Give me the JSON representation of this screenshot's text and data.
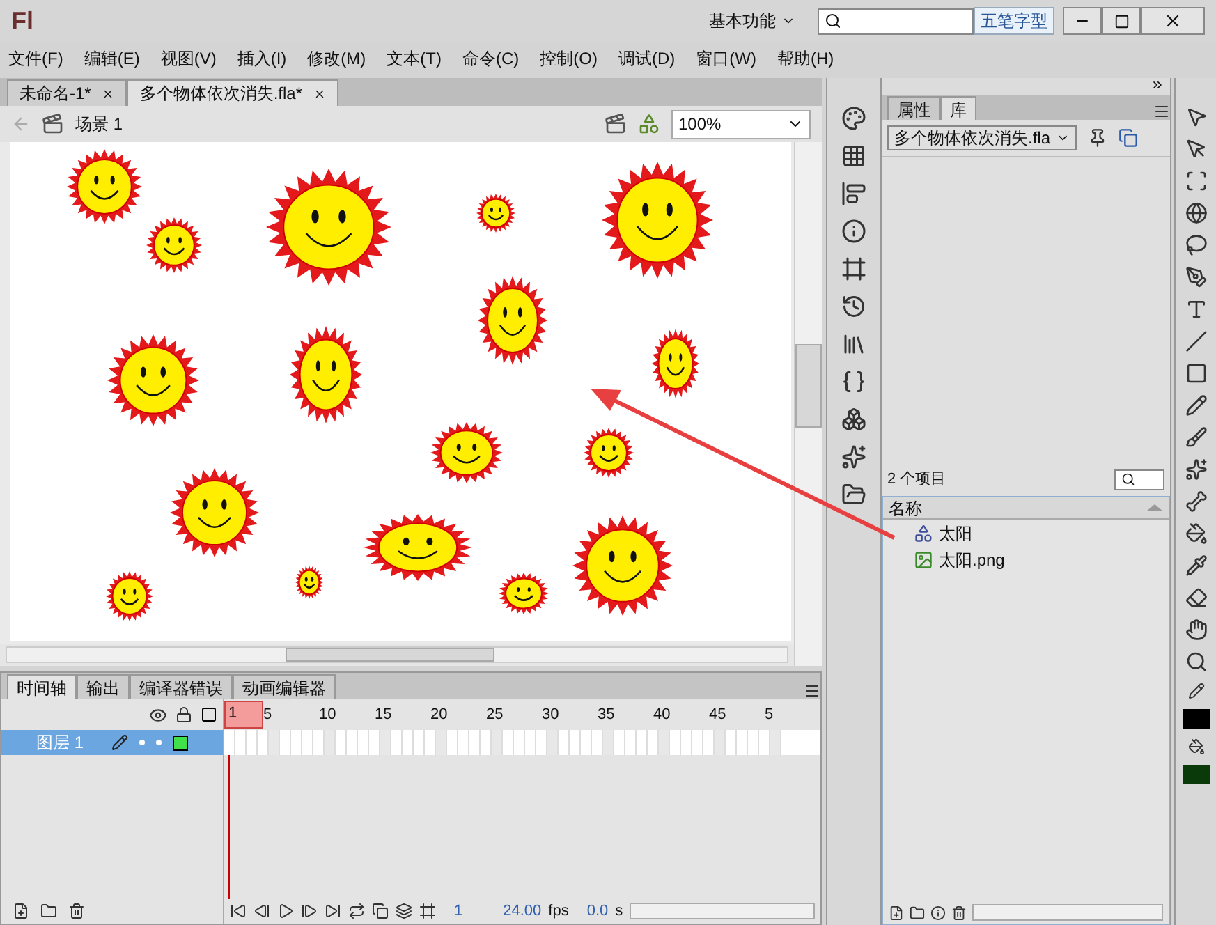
{
  "app": {
    "logo": "Fl",
    "workspace": "基本功能",
    "ime": "五笔字型"
  },
  "menu": [
    "文件(F)",
    "编辑(E)",
    "视图(V)",
    "插入(I)",
    "修改(M)",
    "文本(T)",
    "命令(C)",
    "控制(O)",
    "调试(D)",
    "窗口(W)",
    "帮助(H)"
  ],
  "doc_tabs": [
    {
      "label": "未命名-1*",
      "selected": false
    },
    {
      "label": "多个物体依次消失.fla*",
      "selected": true
    }
  ],
  "edit_bar": {
    "scene": "场景 1",
    "zoom": "100%"
  },
  "timeline": {
    "tabs": [
      {
        "label": "时间轴",
        "selected": true
      },
      {
        "label": "输出",
        "selected": false
      },
      {
        "label": "编译器错误",
        "selected": false
      },
      {
        "label": "动画编辑器",
        "selected": false
      }
    ],
    "frame_numbers": [
      "1",
      "5",
      "10",
      "15",
      "20",
      "25",
      "30",
      "35",
      "40",
      "45",
      "5"
    ],
    "layers": [
      {
        "name": "图层 1",
        "selected": true
      }
    ],
    "status": {
      "frame": "1",
      "fps": "24.00",
      "fps_unit": "fps",
      "time": "0.0",
      "time_unit": "s"
    }
  },
  "panel": {
    "tabs": [
      {
        "label": "属性",
        "selected": false
      },
      {
        "label": "库",
        "selected": true
      }
    ],
    "document": "多个物体依次消失.fla",
    "count": "2 个项目",
    "column": "名称",
    "items": [
      {
        "kind": "symbol",
        "name": "太阳"
      },
      {
        "kind": "bitmap",
        "name": "太阳.png"
      }
    ]
  }
}
